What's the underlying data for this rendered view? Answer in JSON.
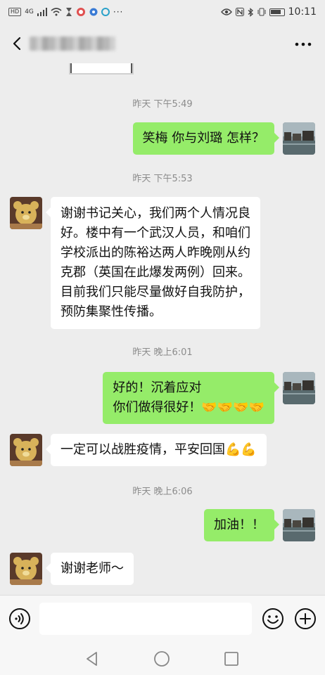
{
  "status_bar": {
    "left_badge": "HD",
    "network": "4G",
    "time": "10:11"
  },
  "messages": [
    {
      "type": "timestamp",
      "text": "昨天 下午5:49"
    },
    {
      "type": "message",
      "side": "right",
      "lines": [
        "笑梅 你与刘璐  怎样？"
      ]
    },
    {
      "type": "timestamp",
      "text": "昨天 下午5:53"
    },
    {
      "type": "message",
      "side": "left",
      "lines": [
        "谢谢书记关心，我们两个人情况良",
        "好。楼中有一个武汉人员，和咱们",
        "学校派出的陈裕达两人昨晚刚从约",
        "克郡（英国在此爆发两例）回来。",
        "目前我们只能尽量做好自我防护，",
        "预防集聚性传播。"
      ]
    },
    {
      "type": "timestamp",
      "text": "昨天 晚上6:01"
    },
    {
      "type": "message",
      "side": "right",
      "lines": [
        "好的！沉着应对",
        "你们做得很好！🤝🤝🤝🤝"
      ]
    },
    {
      "type": "message",
      "side": "left",
      "lines": [
        "一定可以战胜疫情，平安回国💪💪"
      ]
    },
    {
      "type": "timestamp",
      "text": "昨天 晚上6:06"
    },
    {
      "type": "message",
      "side": "right",
      "lines": [
        "加油！！"
      ]
    },
    {
      "type": "message",
      "side": "left",
      "lines": [
        "谢谢老师～"
      ]
    }
  ],
  "colors": {
    "background": "#ededed",
    "sent_bubble": "#95ec69",
    "received_bubble": "#ffffff",
    "timestamp": "#8c8c8c"
  },
  "icons": {
    "back": "chevron-left-icon",
    "more": "more-dots-icon",
    "voice": "voice-icon",
    "emoji": "emoji-icon",
    "plus": "plus-icon"
  }
}
